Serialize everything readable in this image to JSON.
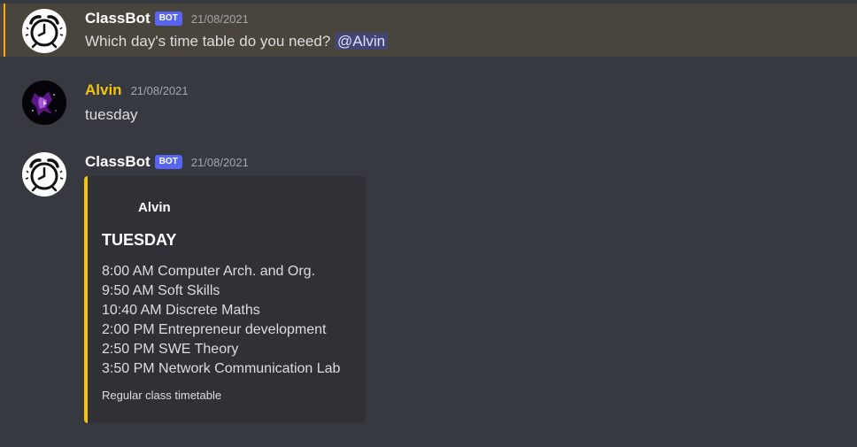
{
  "messages": [
    {
      "username": "ClassBot",
      "tag": "BOT",
      "timestamp": "21/08/2021",
      "text": "Which day's time table do you need?",
      "mention": "@Alvin"
    },
    {
      "username": "Alvin",
      "timestamp": "21/08/2021",
      "text": "tuesday"
    },
    {
      "username": "ClassBot",
      "tag": "BOT",
      "timestamp": "21/08/2021",
      "embed": {
        "author": "Alvin",
        "title": "TUESDAY",
        "lines": [
          "8:00 AM Computer Arch. and Org.",
          "9:50 AM Soft Skills",
          "10:40 AM Discrete Maths",
          "2:00 PM Entrepreneur development",
          "2:50 PM SWE Theory",
          "3:50 PM Network Communication Lab"
        ],
        "footer": "Regular class timetable"
      }
    }
  ],
  "colors": {
    "background": "#36393f",
    "highlight": "#49443c",
    "highlight_bar": "#faa81a",
    "bot_tag": "#5865f2",
    "alvin_name": "#f1c40f",
    "embed_bar": "#f1c40f",
    "embed_bg": "#2f3136",
    "mention_bg": "#414675"
  },
  "icons": {
    "bot_avatar": "alarm-clock-icon",
    "user_avatar": "purple-nebula-avatar"
  }
}
